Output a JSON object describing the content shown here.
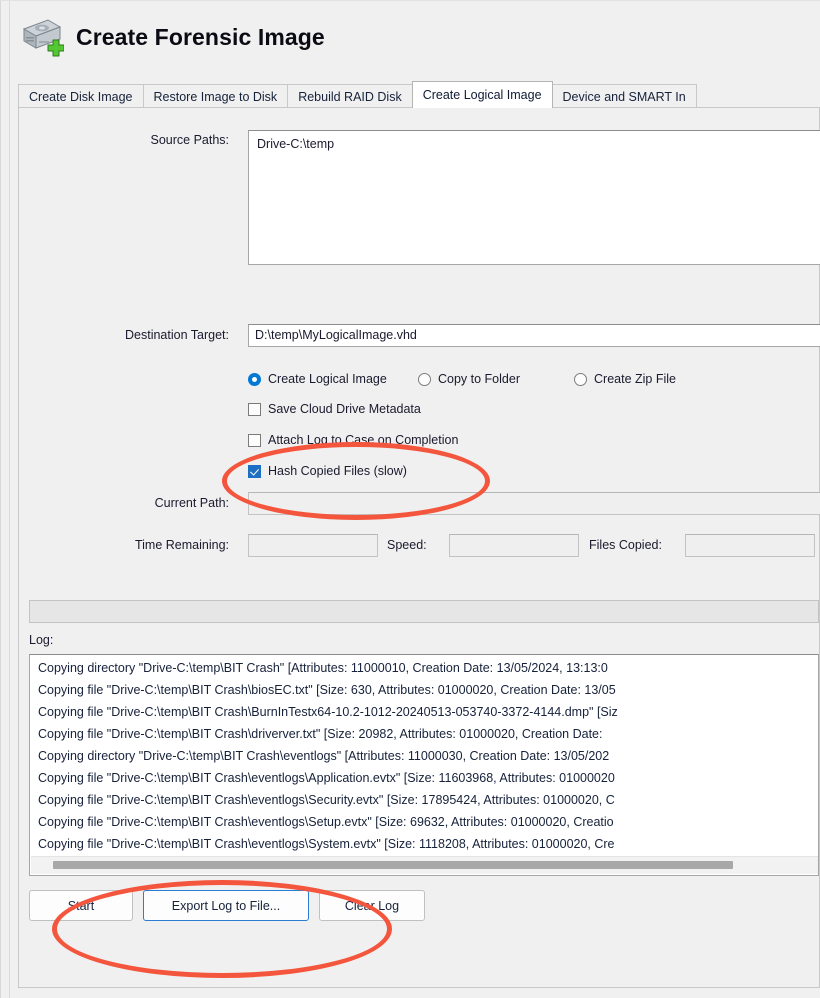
{
  "window": {
    "title": "Create Forensic Image",
    "icon": "hard-drive-add-icon"
  },
  "tabs": [
    {
      "label": "Create Disk Image",
      "selected": false
    },
    {
      "label": "Restore Image to Disk",
      "selected": false
    },
    {
      "label": "Rebuild RAID Disk",
      "selected": false
    },
    {
      "label": "Create Logical Image",
      "selected": true
    },
    {
      "label": "Device and SMART In",
      "selected": false
    }
  ],
  "form": {
    "source_paths_label": "Source Paths:",
    "source_paths_value": "Drive-C:\\temp",
    "destination_label": "Destination Target:",
    "destination_value": "D:\\temp\\MyLogicalImage.vhd",
    "output_modes": [
      {
        "label": "Create Logical Image",
        "checked": true
      },
      {
        "label": "Copy to Folder",
        "checked": false
      },
      {
        "label": "Create Zip File",
        "checked": false
      }
    ],
    "options": [
      {
        "label": "Save Cloud Drive Metadata",
        "checked": false
      },
      {
        "label": "Attach Log to Case on Completion",
        "checked": false
      },
      {
        "label": "Hash Copied Files (slow)",
        "checked": true
      }
    ],
    "current_path_label": "Current Path:",
    "current_path_value": "",
    "time_remaining_label": "Time Remaining:",
    "time_remaining_value": "",
    "speed_label": "Speed:",
    "speed_value": "",
    "files_copied_label": "Files Copied:",
    "files_copied_value": "",
    "progress_percent": 0
  },
  "log": {
    "label": "Log:",
    "lines": [
      "Copying directory \"Drive-C:\\temp\\BIT Crash\" [Attributes: 11000010, Creation Date: 13/05/2024, 13:13:0",
      "Copying file \"Drive-C:\\temp\\BIT Crash\\biosEC.txt\" [Size: 630, Attributes: 01000020, Creation Date: 13/05",
      "Copying file \"Drive-C:\\temp\\BIT Crash\\BurnInTestx64-10.2-1012-20240513-053740-3372-4144.dmp\" [Siz",
      "Copying file \"Drive-C:\\temp\\BIT Crash\\driverver.txt\" [Size: 20982, Attributes: 01000020, Creation Date:",
      "Copying directory \"Drive-C:\\temp\\BIT Crash\\eventlogs\" [Attributes: 11000030, Creation Date: 13/05/202",
      "Copying file \"Drive-C:\\temp\\BIT Crash\\eventlogs\\Application.evtx\" [Size: 11603968, Attributes: 01000020",
      "Copying file \"Drive-C:\\temp\\BIT Crash\\eventlogs\\Security.evtx\" [Size: 17895424, Attributes: 01000020, C",
      "Copying file \"Drive-C:\\temp\\BIT Crash\\eventlogs\\Setup.evtx\" [Size: 69632, Attributes: 01000020, Creatio",
      "Copying file \"Drive-C:\\temp\\BIT Crash\\eventlogs\\System.evtx\" [Size: 1118208, Attributes: 01000020, Cre"
    ]
  },
  "buttons": [
    {
      "label": "Start",
      "focused": false
    },
    {
      "label": "Export Log to File...",
      "focused": true
    },
    {
      "label": "Clear Log",
      "focused": false
    }
  ],
  "annotations": {
    "color": "#f4553d",
    "shapes": [
      "ellipse-around-hash-copied-files",
      "ellipse-around-export-log-button"
    ]
  }
}
